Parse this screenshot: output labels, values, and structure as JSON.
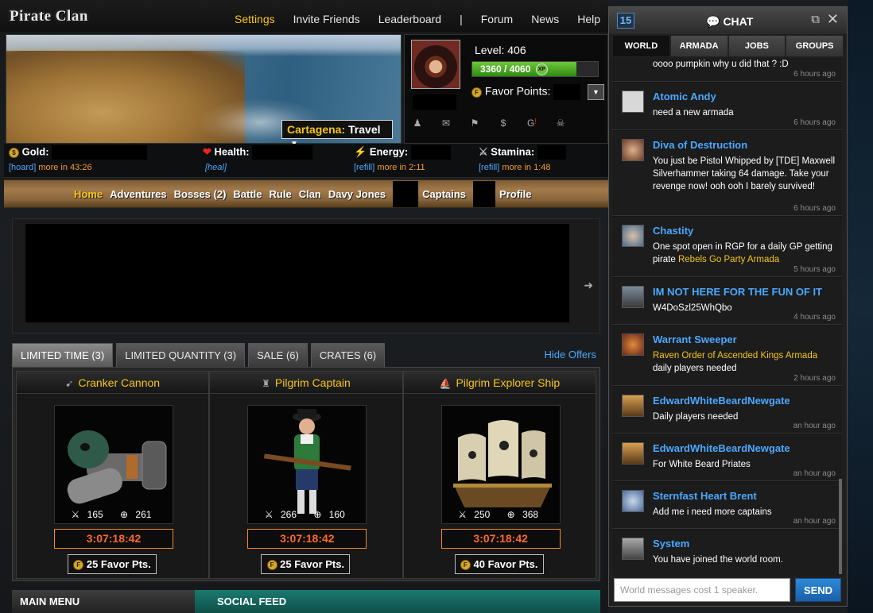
{
  "logo": "Pirate Clan",
  "topnav": [
    "Settings",
    "Invite Friends",
    "Leaderboard",
    "|",
    "Forum",
    "News",
    "Help"
  ],
  "travel": {
    "location": "Cartagena:",
    "label": "Travel"
  },
  "profile": {
    "level": "Level: 406",
    "xp_text": "3360 / 4060",
    "xp_fraction": 0.8276,
    "xp_badge": "XP",
    "favor_label": "Favor Points:"
  },
  "stats": {
    "gold": {
      "label": "Gold:",
      "link": "[hoard]",
      "timer": "more in 43:26"
    },
    "health": {
      "label": "Health:",
      "link": "[heal]"
    },
    "energy": {
      "label": "Energy:",
      "link": "[refill]",
      "timer": "more in 2:11"
    },
    "stamina": {
      "label": "Stamina:",
      "link": "[refill]",
      "timer": "more in 1:48"
    }
  },
  "mainnav": [
    "Home",
    "Adventures",
    "Bosses (2)",
    "Battle",
    "Rule",
    "Clan",
    "Davy Jones",
    "Captains",
    "Profile"
  ],
  "offer_tabs": [
    "LIMITED TIME (3)",
    "LIMITED QUANTITY (3)",
    "SALE (6)",
    "CRATES (6)"
  ],
  "hide_offers": "Hide Offers",
  "offers": [
    {
      "title": "Cranker Cannon",
      "attack": "165",
      "defense": "261",
      "timer": "3:07:18:42",
      "price": "25 Favor Pts."
    },
    {
      "title": "Pilgrim Captain",
      "attack": "266",
      "defense": "160",
      "timer": "3:07:18:42",
      "price": "25 Favor Pts."
    },
    {
      "title": "Pilgrim Explorer Ship",
      "attack": "250",
      "defense": "368",
      "timer": "3:07:18:42",
      "price": "40 Favor Pts."
    }
  ],
  "bottom": {
    "main_menu": "MAIN MENU",
    "social_feed": "SOCIAL FEED"
  },
  "chat": {
    "count": "15",
    "title": "CHAT",
    "tabs": [
      "WORLD",
      "ARMADA",
      "JOBS",
      "GROUPS"
    ],
    "messages": [
      {
        "name": "",
        "text": "oooo pumpkin why u did that ? :D",
        "time": "6 hours ago"
      },
      {
        "name": "Atomic Andy",
        "text": "need a new armada",
        "time": "6 hours ago"
      },
      {
        "name": "Diva of Destruction",
        "text": "You just be Pistol Whipped by [TDE] Maxwell Silverhammer taking 64 damage. Take your revenge now! ooh ooh I barely survived!",
        "time": "6 hours ago"
      },
      {
        "name": "Chastity",
        "text": "One spot open in RGP for a daily GP getting pirate",
        "highlight": "Rebels Go Party Armada",
        "time": "5 hours ago"
      },
      {
        "name": "IM NOT HERE FOR THE FUN OF IT",
        "text": "W4DoSzl25WhQbo",
        "time": "4 hours ago"
      },
      {
        "name": "Warrant Sweeper",
        "highlight": "Raven Order of Ascended Kings Armada",
        "text": "daily players needed",
        "time": "2 hours ago"
      },
      {
        "name": "EdwardWhiteBeardNewgate",
        "text": "Daily players needed",
        "time": "an hour ago"
      },
      {
        "name": "EdwardWhiteBeardNewgate",
        "text": "For White Beard Priates",
        "time": "an hour ago"
      },
      {
        "name": "Sternfast Heart Brent",
        "text": "Add me i need more captains",
        "time": "an hour ago"
      },
      {
        "name": "System",
        "text": "You have joined the world room.",
        "time": ""
      }
    ],
    "input_placeholder": "World messages cost 1 speaker.",
    "send": "SEND"
  },
  "colors": {
    "accent_gold": "#f5c518",
    "link_blue": "#4aa8ff",
    "timer_orange": "#ff6a2a"
  }
}
